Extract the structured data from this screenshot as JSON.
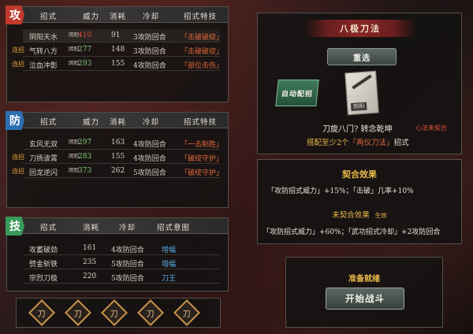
{
  "attack": {
    "icon": "攻",
    "headers": [
      "招式",
      "威力",
      "消耗",
      "冷却",
      "招式特技"
    ],
    "rows": [
      {
        "name": "阴阳天水",
        "lian": "",
        "badge": "阴阳",
        "power": "410",
        "power_color": "red",
        "cost": "91",
        "cooldown": "3攻防回合",
        "effect": "「击破破绽」"
      },
      {
        "name": "气转八方",
        "lian": "连招",
        "badge": "阴阳",
        "power": "277",
        "power_color": "green",
        "cost": "148",
        "cooldown": "3攻防回合",
        "effect": "「击破破绽」"
      },
      {
        "name": "泣血冲影",
        "lian": "连招",
        "badge": "阴阳",
        "power": "293",
        "power_color": "green",
        "cost": "155",
        "cooldown": "4攻防回合",
        "effect": "「部位击伤」"
      }
    ]
  },
  "defense": {
    "icon": "防",
    "headers": [
      "招式",
      "威力",
      "消耗",
      "冷却",
      "招式特技"
    ],
    "rows": [
      {
        "name": "玄风无双",
        "lian": "",
        "badge": "阴阳",
        "power": "297",
        "power_color": "green",
        "cost": "163",
        "cooldown": "4攻防回合",
        "effect": "「一击制胜」"
      },
      {
        "name": "刀扬波霄",
        "lian": "连招",
        "badge": "阴阳",
        "power": "283",
        "power_color": "green",
        "cost": "155",
        "cooldown": "4攻防回合",
        "effect": "「破绽守护」"
      },
      {
        "name": "回龙逆闪",
        "lian": "连招",
        "badge": "阴阳",
        "power": "373",
        "power_color": "green",
        "cost": "262",
        "cooldown": "5攻防回合",
        "effect": "「破绽守护」"
      }
    ]
  },
  "skill": {
    "icon": "技",
    "headers": [
      "招式",
      "消耗",
      "冷却",
      "招式意图"
    ],
    "rows": [
      {
        "name": "攻蓄破劲",
        "cost": "161",
        "cooldown": "4攻防回合",
        "intent": "增幅"
      },
      {
        "name": "劈金斩铁",
        "cost": "235",
        "cooldown": "5攻防回合",
        "intent": "增幅"
      },
      {
        "name": "宗烈刀极",
        "cost": "220",
        "cooldown": "5攻防回合",
        "intent": "刀王"
      }
    ]
  },
  "skill_slots": [
    "刀",
    "刀",
    "刀",
    "刀",
    "刀"
  ],
  "right": {
    "title": "八极刀法",
    "reselect_label": "重选",
    "auto_label": "自动配招",
    "book_badge": "阴阳",
    "book_caption": "刀旋八门? 转念乾坤",
    "xinfa_status": "心法未契合",
    "requirement_prefix": "搭配至少2个",
    "requirement_highlight": "「两仪刀法」",
    "requirement_suffix": "招式",
    "fit_title": "契合效果",
    "fit_line_1a": "「攻防招式威力」+15%；",
    "fit_line_1b": "「击破」几率+10%",
    "unfit_title": "未契合效果",
    "unfit_tag": "生效",
    "unfit_line_a": "「攻防招式威力」+60%；",
    "unfit_line_b": "「武功招式冷却」+2攻防回合",
    "ready_label": "准备就绪",
    "start_label": "开始战斗"
  },
  "colors": {
    "attack_icon": "#c0392b",
    "defense_icon": "#2c6fb0",
    "skill_icon": "#3a9a5a",
    "accent_gold": "#e8b94a",
    "effect_red": "#e06a3a"
  }
}
